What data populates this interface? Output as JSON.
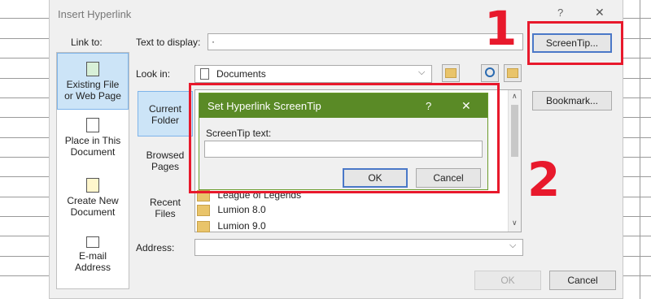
{
  "dialog": {
    "title": "Insert Hyperlink",
    "help": "?",
    "close": "✕",
    "link_to_label": "Link to:",
    "text_to_display_label": "Text to display:",
    "text_to_display_value": "·",
    "screentip_button": "ScreenTip...",
    "look_in_label": "Look in:",
    "look_in_value": "Documents",
    "bookmark_button": "Bookmark...",
    "address_label": "Address:",
    "address_value": "",
    "ok_button": "OK",
    "cancel_button": "Cancel",
    "sidebar": [
      {
        "line1": "Existing File",
        "line2": "or Web Page"
      },
      {
        "line1": "Place in This",
        "line2": "Document"
      },
      {
        "line1": "Create New",
        "line2": "Document"
      },
      {
        "line1": "E-mail",
        "line2": "Address"
      }
    ],
    "tabs": [
      {
        "line1": "Current",
        "line2": "Folder"
      },
      {
        "line1": "Browsed",
        "line2": "Pages"
      },
      {
        "line1": "Recent",
        "line2": "Files"
      }
    ],
    "files": [
      "League of Legends",
      "Lumion 8.0",
      "Lumion 9.0"
    ]
  },
  "screentip_dialog": {
    "title": "Set Hyperlink ScreenTip",
    "help": "?",
    "close": "✕",
    "field_label": "ScreenTip text:",
    "field_value": "",
    "ok_button": "OK",
    "cancel_button": "Cancel"
  },
  "annotations": {
    "step1": "1",
    "step2": "2"
  },
  "colors": {
    "accent_red": "#e8192c",
    "title_green": "#5a8a26",
    "selected_blue": "#cce4f7"
  }
}
